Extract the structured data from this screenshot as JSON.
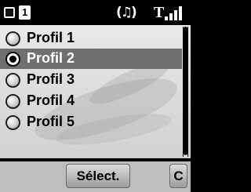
{
  "status_bar": {
    "line_number": "1",
    "icons": [
      "message-icon",
      "line-1-icon",
      "ringtone-icon",
      "signal-strength-icon"
    ]
  },
  "profiles": {
    "items": [
      {
        "label": "Profil 1",
        "selected": false
      },
      {
        "label": "Profil 2",
        "selected": true
      },
      {
        "label": "Profil 3",
        "selected": false
      },
      {
        "label": "Profil 4",
        "selected": false
      },
      {
        "label": "Profil 5",
        "selected": false
      }
    ]
  },
  "softkeys": {
    "select_label": "Sélect.",
    "clear_label": "C"
  }
}
